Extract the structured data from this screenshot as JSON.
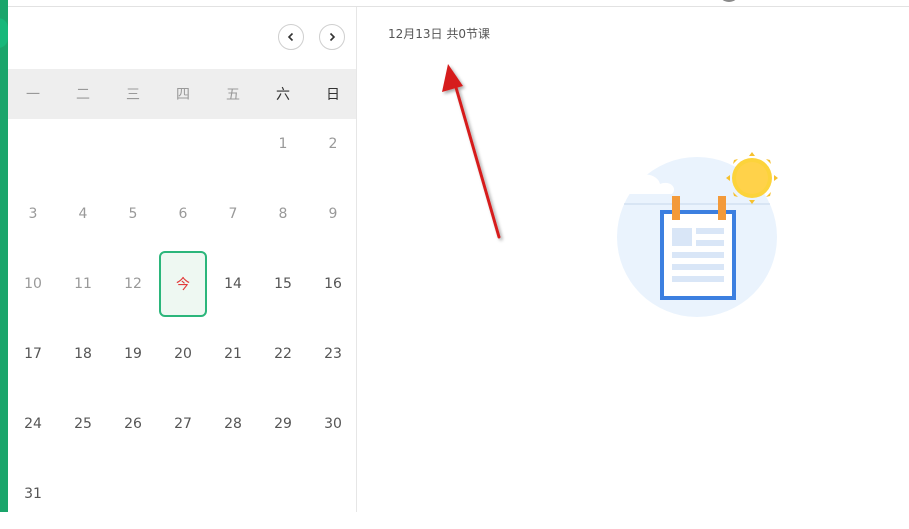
{
  "calendar": {
    "weekdays": [
      "一",
      "二",
      "三",
      "四",
      "五",
      "六",
      "日"
    ],
    "days": [
      {
        "label": "",
        "kind": "empty"
      },
      {
        "label": "",
        "kind": "empty"
      },
      {
        "label": "",
        "kind": "empty"
      },
      {
        "label": "",
        "kind": "empty"
      },
      {
        "label": "",
        "kind": "empty"
      },
      {
        "label": "1",
        "kind": "past"
      },
      {
        "label": "2",
        "kind": "past"
      },
      {
        "label": "3",
        "kind": "past"
      },
      {
        "label": "4",
        "kind": "past"
      },
      {
        "label": "5",
        "kind": "past"
      },
      {
        "label": "6",
        "kind": "past"
      },
      {
        "label": "7",
        "kind": "past"
      },
      {
        "label": "8",
        "kind": "past"
      },
      {
        "label": "9",
        "kind": "past"
      },
      {
        "label": "10",
        "kind": "past"
      },
      {
        "label": "11",
        "kind": "past"
      },
      {
        "label": "12",
        "kind": "past"
      },
      {
        "label": "今",
        "kind": "today"
      },
      {
        "label": "14",
        "kind": "future"
      },
      {
        "label": "15",
        "kind": "future"
      },
      {
        "label": "16",
        "kind": "future"
      },
      {
        "label": "17",
        "kind": "future"
      },
      {
        "label": "18",
        "kind": "future"
      },
      {
        "label": "19",
        "kind": "future"
      },
      {
        "label": "20",
        "kind": "future"
      },
      {
        "label": "21",
        "kind": "future"
      },
      {
        "label": "22",
        "kind": "future"
      },
      {
        "label": "23",
        "kind": "future"
      },
      {
        "label": "24",
        "kind": "future"
      },
      {
        "label": "25",
        "kind": "future"
      },
      {
        "label": "26",
        "kind": "future"
      },
      {
        "label": "27",
        "kind": "future"
      },
      {
        "label": "28",
        "kind": "future"
      },
      {
        "label": "29",
        "kind": "future"
      },
      {
        "label": "30",
        "kind": "future"
      },
      {
        "label": "31",
        "kind": "future"
      }
    ],
    "prev_icon": "chevron-left-icon",
    "next_icon": "chevron-right-icon"
  },
  "schedule": {
    "summary": "12月13日 共0节课"
  },
  "colors": {
    "accent_green": "#2bb67b",
    "today_red": "#e23a3a",
    "annotation_arrow": "#d61f1f"
  }
}
